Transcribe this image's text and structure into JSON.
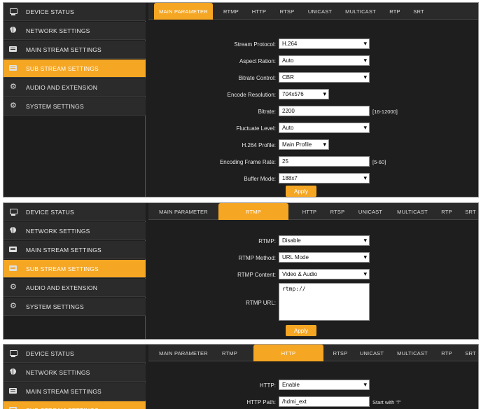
{
  "sidebar": [
    {
      "label": "DEVICE STATUS",
      "icon": "monitor-icon"
    },
    {
      "label": "NETWORK SETTINGS",
      "icon": "globe-icon"
    },
    {
      "label": "MAIN STREAM SETTINGS",
      "icon": "screen-icon"
    },
    {
      "label": "SUB STREAM SETTINGS",
      "icon": "screen-icon"
    },
    {
      "label": "AUDIO AND EXTENSION",
      "icon": "gear-icon"
    },
    {
      "label": "SYSTEM SETTINGS",
      "icon": "gear-icon"
    }
  ],
  "accent_color": "#f5a623",
  "panel1": {
    "tabs": [
      "MAIN PARAMETER",
      "RTMP",
      "HTTP",
      "RTSP",
      "UNICAST",
      "MULTICAST",
      "RTP",
      "SRT"
    ],
    "fields": {
      "stream_protocol": {
        "label": "Stream Protocol:",
        "value": "H.264"
      },
      "aspect_ration": {
        "label": "Aspect Ration:",
        "value": "Auto"
      },
      "bitrate_control": {
        "label": "Bitrate Control:",
        "value": "CBR"
      },
      "encode_resolution": {
        "label": "Encode Resolution:",
        "value": "704x576"
      },
      "bitrate": {
        "label": "Bitrate:",
        "value": "2200",
        "hint": "[16-12000]"
      },
      "fluctuate_level": {
        "label": "Fluctuate Level:",
        "value": "Auto"
      },
      "h264_profile": {
        "label": "H.264 Profile:",
        "value": "Main Profile"
      },
      "encoding_frame_rate": {
        "label": "Encoding Frame Rate:",
        "value": "25",
        "hint": "[5-60]"
      },
      "buffer_mode": {
        "label": "Buffer Mode:",
        "value": "188x7"
      }
    },
    "apply_label": "Apply"
  },
  "panel2": {
    "tabs": [
      "MAIN PARAMETER",
      "RTMP",
      "HTTP",
      "RTSP",
      "UNICAST",
      "MULTICAST",
      "RTP",
      "SRT"
    ],
    "fields": {
      "rtmp": {
        "label": "RTMP:",
        "value": "Disable"
      },
      "rtmp_method": {
        "label": "RTMP Method:",
        "value": "URL Mode"
      },
      "rtmp_content": {
        "label": "RTMP Content:",
        "value": "Video & Audio"
      },
      "rtmp_url": {
        "label": "RTMP URL:",
        "value": "rtmp://"
      }
    },
    "apply_label": "Apply"
  },
  "panel3": {
    "tabs": [
      "MAIN PARAMETER",
      "RTMP",
      "HTTP",
      "RTSP",
      "UNICAST",
      "MULTICAST",
      "RTP",
      "SRT"
    ],
    "fields": {
      "http": {
        "label": "HTTP:",
        "value": "Enable"
      },
      "http_path": {
        "label": "HTTP Path:",
        "value": "/hdmi_ext",
        "hint": "Start with \"/\""
      }
    }
  }
}
